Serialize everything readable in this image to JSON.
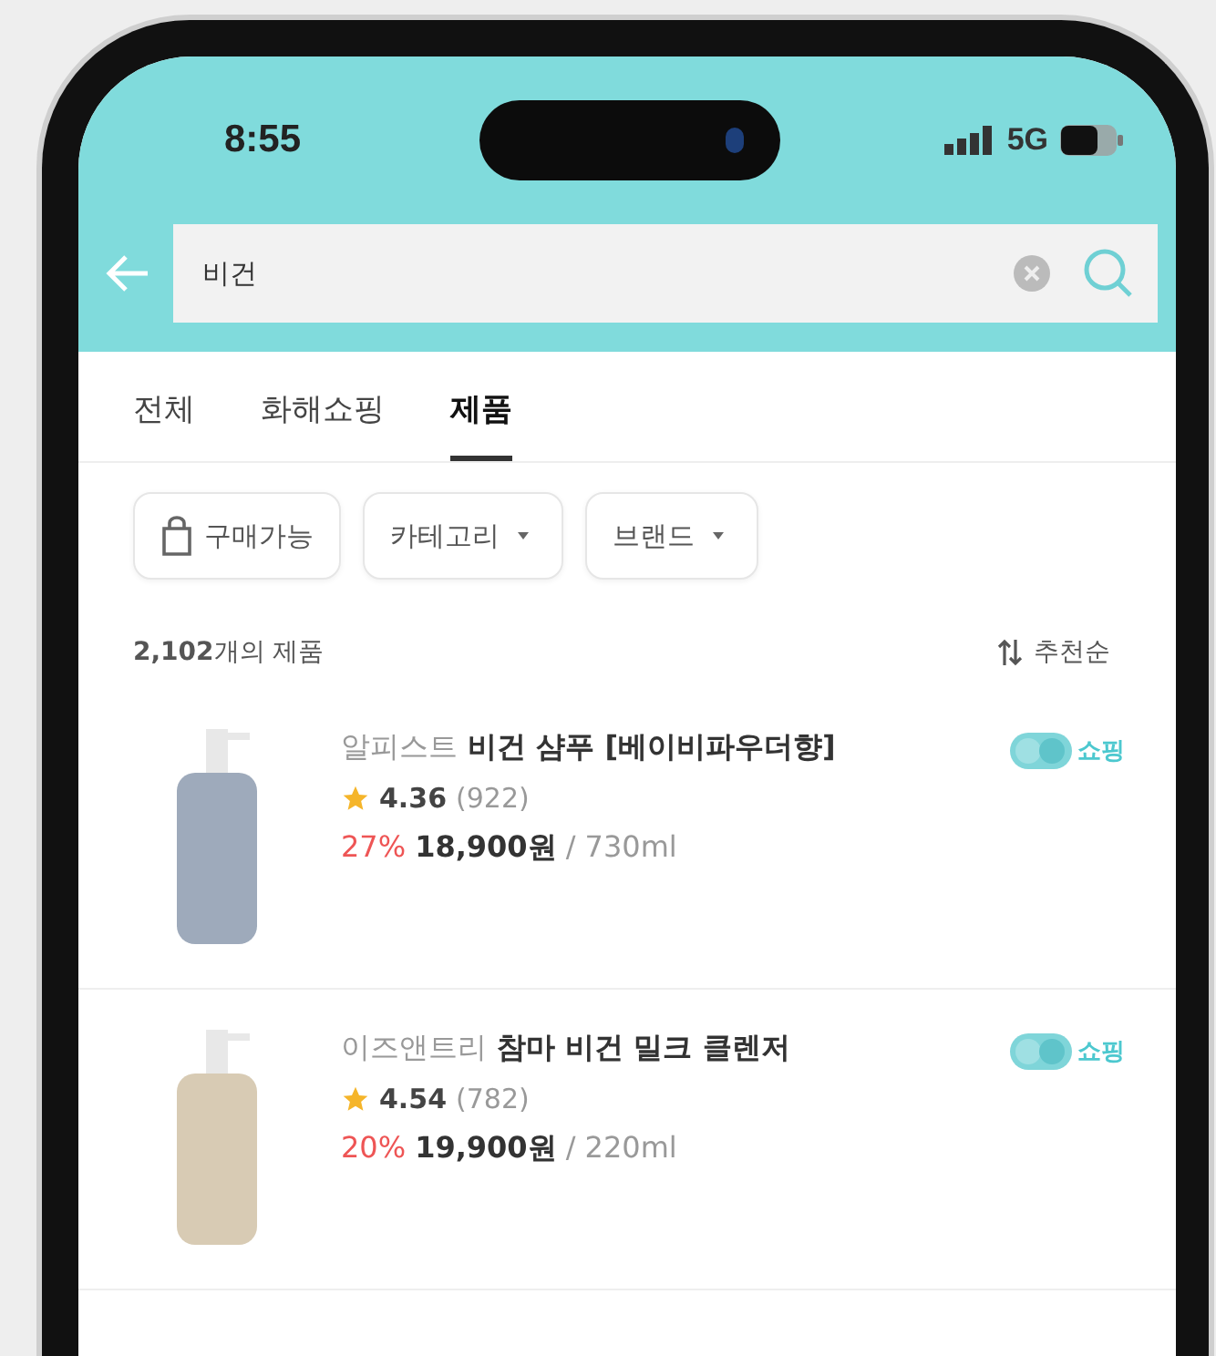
{
  "status_bar": {
    "time": "8:55",
    "network": "5G"
  },
  "search": {
    "value": "비건"
  },
  "tabs": [
    {
      "label": "전체",
      "selected": false
    },
    {
      "label": "화해쇼핑",
      "selected": false
    },
    {
      "label": "제품",
      "selected": true
    }
  ],
  "filters": [
    {
      "label": "구매가능",
      "kind": "toggle"
    },
    {
      "label": "카테고리",
      "kind": "dropdown"
    },
    {
      "label": "브랜드",
      "kind": "dropdown"
    }
  ],
  "result_count": "**2,102**개의 제품",
  "sort": {
    "label": "추천순"
  },
  "products": [
    {
      "brand": "알피스트",
      "name": "비건 샴푸 [베이비파우더향]",
      "rating": "4.36",
      "reviews": "(922)",
      "discount": "27%",
      "price": "18,900원",
      "volume": "/ 730ml",
      "badge": "쇼핑",
      "color": "#9eaabb"
    },
    {
      "brand": "이즈앤트리",
      "name": "참마 비건 밀크 클렌저",
      "rating": "4.54",
      "reviews": "(782)",
      "discount": "20%",
      "price": "19,900원",
      "volume": "/ 220ml",
      "badge": "쇼핑",
      "color": "#d8cbb4"
    }
  ]
}
